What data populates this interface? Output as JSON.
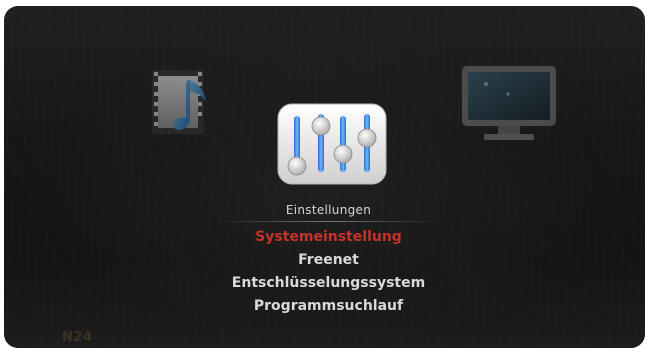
{
  "menu": {
    "title": "Einstellungen",
    "items": [
      {
        "label": "Systemeinstellung",
        "selected": true
      },
      {
        "label": "Freenet",
        "selected": false
      },
      {
        "label": "Entschlüsselungssystem",
        "selected": false
      },
      {
        "label": "Programmsuchlauf",
        "selected": false
      }
    ]
  },
  "icons": {
    "left": "film-music-icon",
    "center": "equalizer-settings-icon",
    "right": "monitor-icon"
  },
  "background": {
    "channel_logo": "N24"
  },
  "colors": {
    "selected_item": "#c8322a",
    "menu_text": "#d9d9d9",
    "title_text": "#d6d6d6",
    "background": "#181818"
  }
}
